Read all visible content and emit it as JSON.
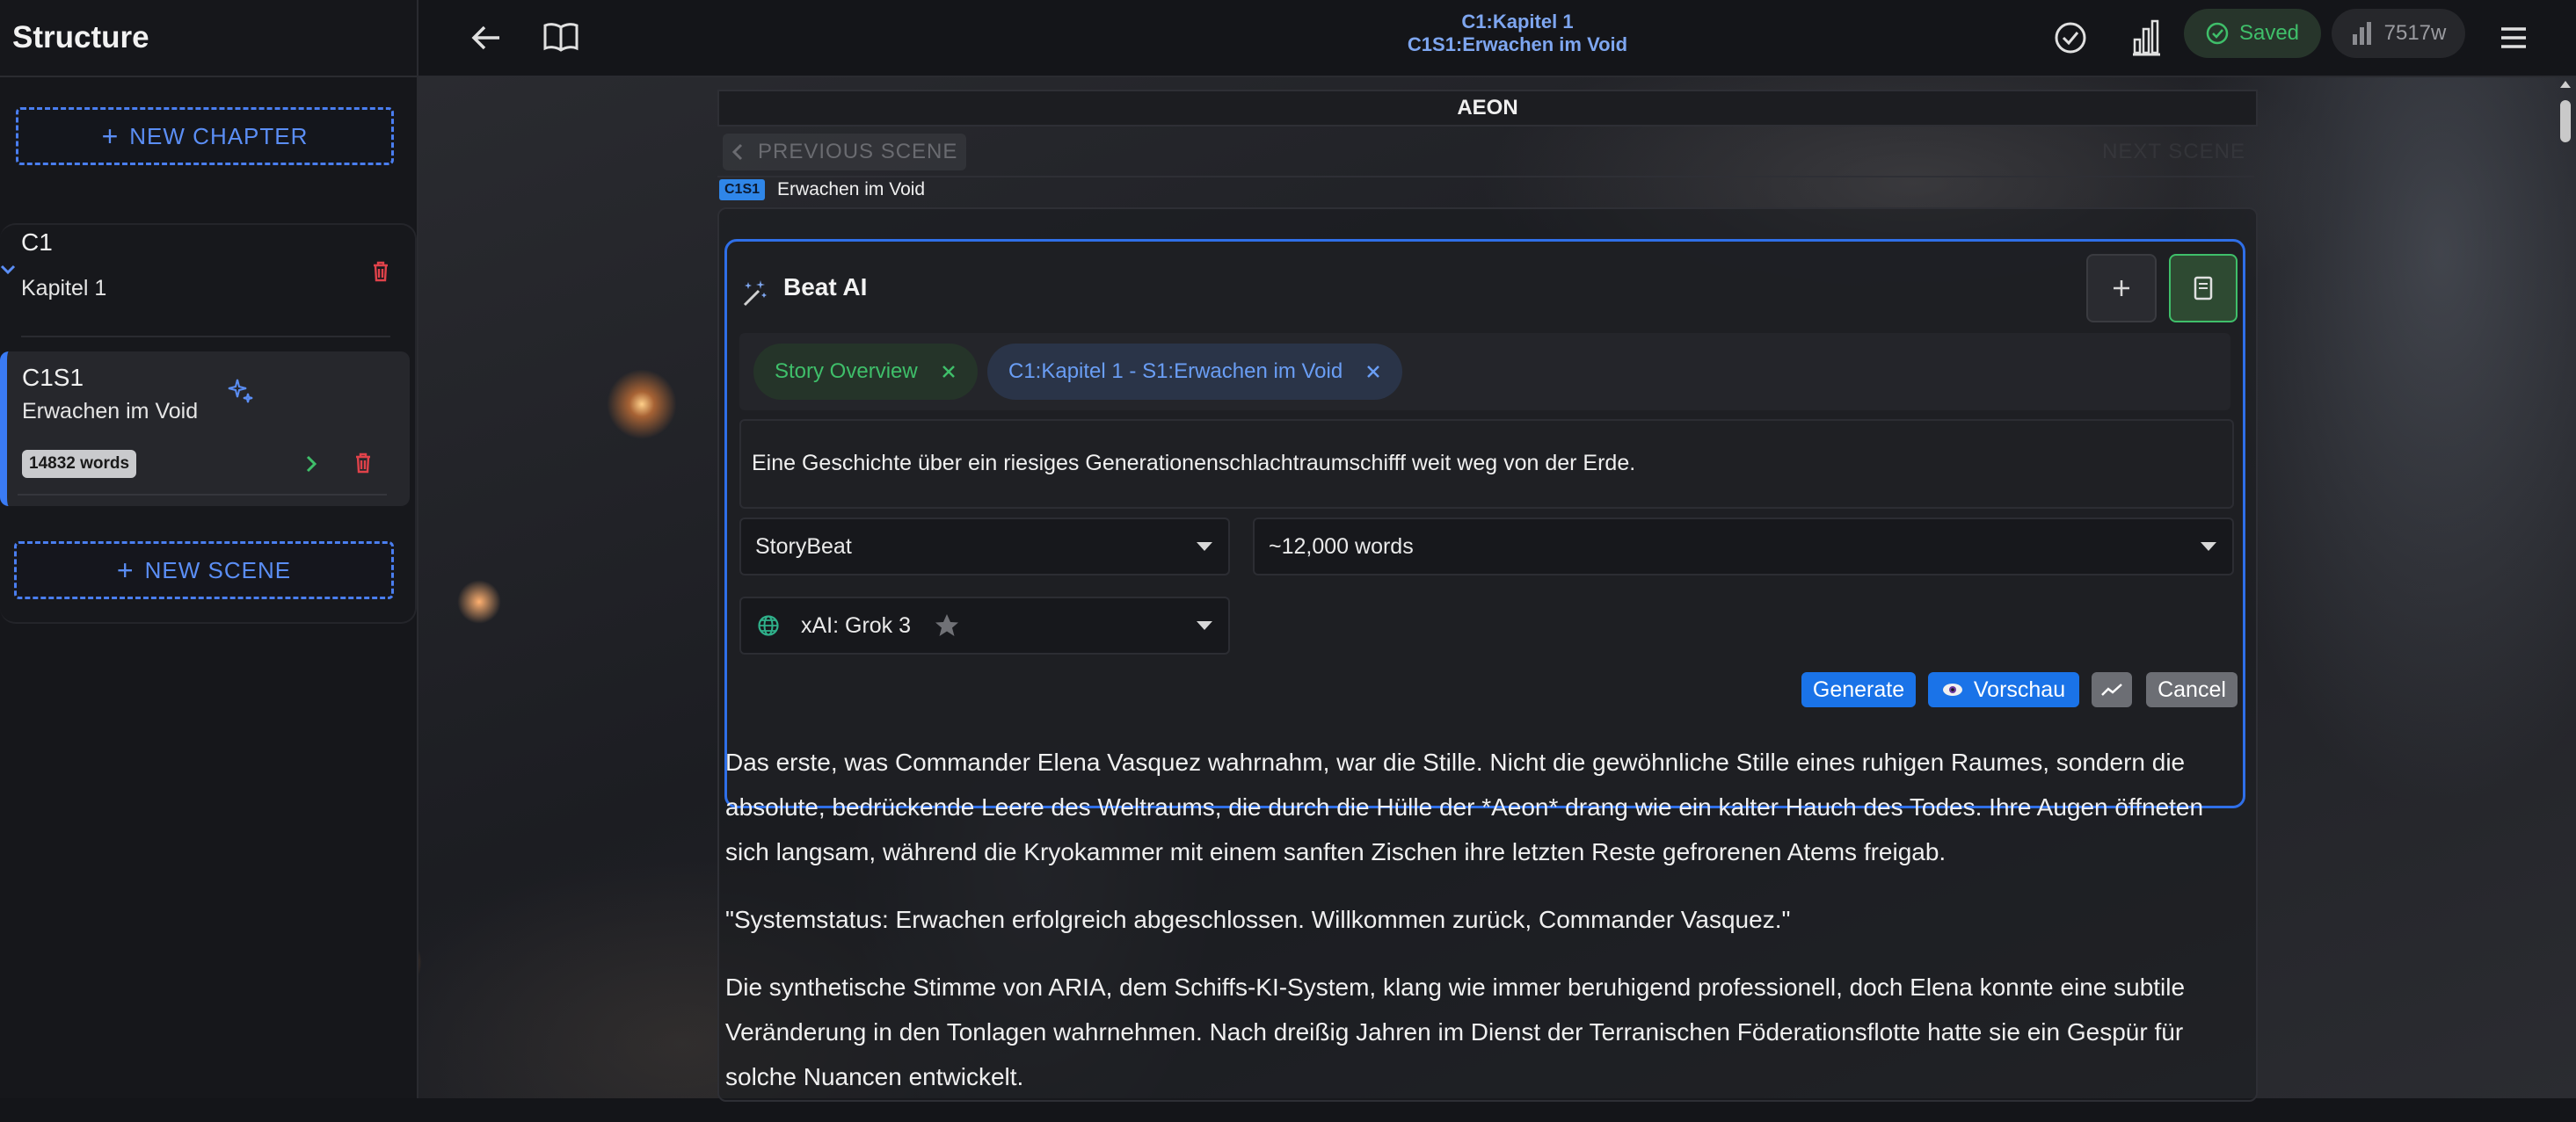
{
  "sidebar": {
    "title": "Structure",
    "new_chapter_label": "NEW CHAPTER",
    "new_scene_label": "NEW SCENE",
    "chapter": {
      "id": "C1",
      "title": "Kapitel 1"
    },
    "scene": {
      "id": "C1S1",
      "title": "Erwachen im Void",
      "word_badge": "14832 words"
    }
  },
  "topbar": {
    "chapter_line": "C1:Kapitel 1",
    "scene_line": "C1S1:Erwachen im Void",
    "saved_label": "Saved",
    "word_count": "7517w"
  },
  "editor": {
    "story_title": "AEON",
    "previous_scene_label": "PREVIOUS SCENE",
    "next_scene_label": "NEXT SCENE",
    "scene_badge": "C1S1",
    "scene_title": "Erwachen im Void"
  },
  "beat_ai": {
    "title": "Beat AI",
    "chips": [
      {
        "label": "Story Overview",
        "color": "#3fbf6a"
      },
      {
        "label": "C1:Kapitel 1 - S1:Erwachen im Void",
        "color": "#6a9ef5"
      }
    ],
    "prompt": "Eine Geschichte über ein riesiges Generationenschlachtraumschifff weit weg von der Erde.",
    "type_select": "StoryBeat",
    "length_select": "~12,000 words",
    "model_select": "xAI: Grok 3",
    "buttons": {
      "generate": "Generate",
      "preview": "Vorschau",
      "cancel": "Cancel"
    }
  },
  "prose": [
    "Das erste, was Commander Elena Vasquez wahrnahm, war die Stille. Nicht die gewöhnliche Stille eines ruhigen Raumes, sondern die absolute, bedrückende Leere des Weltraums, die durch die Hülle der *Aeon* drang wie ein kalter Hauch des Todes. Ihre Augen öffneten sich langsam, während die Kryokammer mit einem sanften Zischen ihre letzten Reste gefrorenen Atems freigab.",
    "\"Systemstatus: Erwachen erfolgreich abgeschlossen. Willkommen zurück, Commander Vasquez.\"",
    "Die synthetische Stimme von ARIA, dem Schiffs-KI-System, klang wie immer beruhigend professionell, doch Elena konnte eine subtile Veränderung in den Tonlagen wahrnehmen. Nach dreißig Jahren im Dienst der Terranischen Föderationsflotte hatte sie ein Gespür für solche Nuancen entwickelt."
  ],
  "colors": {
    "accent": "#2f6fe8",
    "saved_green": "#3fbf6a",
    "delete_red": "#e0424a",
    "generate_blue": "#1a73e8"
  }
}
